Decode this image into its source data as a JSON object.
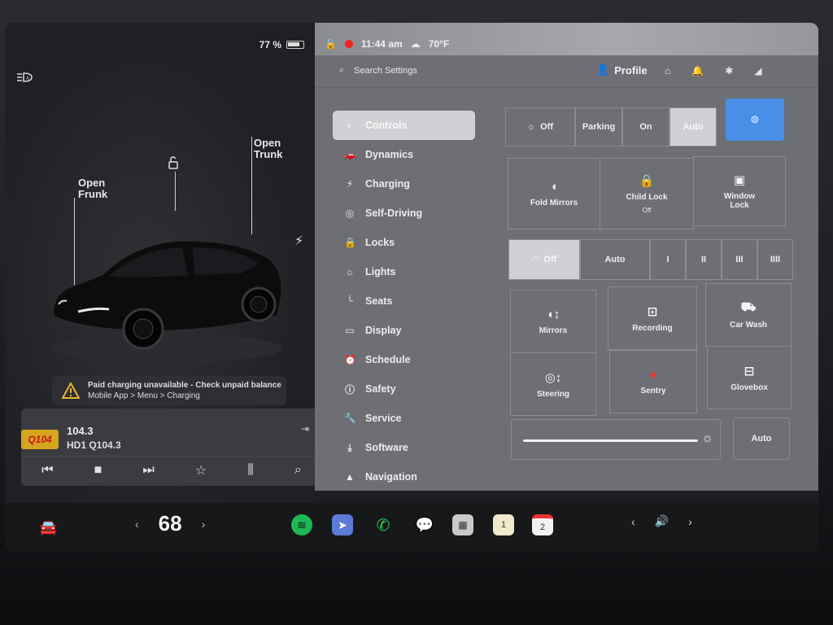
{
  "status": {
    "battery_percent": "77 %",
    "time": "11:44 am",
    "temperature": "70°F",
    "lte": "LTE"
  },
  "car_view": {
    "open_frunk": "Open\nFrunk",
    "open_trunk": "Open\nTrunk",
    "alert_title": "Paid charging unavailable - Check unpaid balance",
    "alert_sub": "Mobile App > Menu > Charging"
  },
  "media": {
    "station_logo": "Q104",
    "frequency": "104.3",
    "station_name": "HD1 Q104.3"
  },
  "header": {
    "search_placeholder": "Search Settings",
    "profile_label": "Profile"
  },
  "menu": {
    "items": [
      {
        "label": "Controls",
        "icon": "toggle-icon"
      },
      {
        "label": "Dynamics",
        "icon": "car-icon"
      },
      {
        "label": "Charging",
        "icon": "bolt-icon"
      },
      {
        "label": "Self-Driving",
        "icon": "steering-icon"
      },
      {
        "label": "Locks",
        "icon": "lock-icon"
      },
      {
        "label": "Lights",
        "icon": "light-icon"
      },
      {
        "label": "Seats",
        "icon": "seat-icon"
      },
      {
        "label": "Display",
        "icon": "display-icon"
      },
      {
        "label": "Schedule",
        "icon": "clock-icon"
      },
      {
        "label": "Safety",
        "icon": "info-icon"
      },
      {
        "label": "Service",
        "icon": "wrench-icon"
      },
      {
        "label": "Software",
        "icon": "download-icon"
      },
      {
        "label": "Navigation",
        "icon": "navigation-icon"
      }
    ]
  },
  "controls": {
    "headlights": [
      "Off",
      "Parking",
      "On",
      "Auto"
    ],
    "fold_mirrors": "Fold Mirrors",
    "child_lock": "Child Lock",
    "child_lock_state": "Off",
    "window_lock": "Window\nLock",
    "wipers": [
      "Off",
      "Auto",
      "I",
      "II",
      "III",
      "IIII"
    ],
    "mirrors": "Mirrors",
    "recording": "Recording",
    "car_wash": "Car Wash",
    "steering": "Steering",
    "sentry": "Sentry",
    "glovebox": "Glovebox",
    "brightness_auto": "Auto"
  },
  "taskbar": {
    "temperature": "68",
    "calendar_day": "2",
    "notes_label": "1"
  }
}
